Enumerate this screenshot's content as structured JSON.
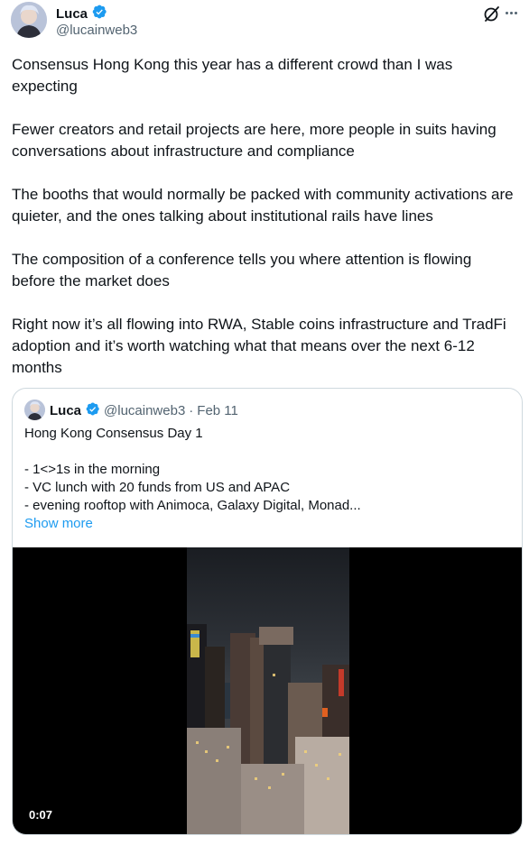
{
  "author": {
    "name": "Luca",
    "handle": "@lucainweb3",
    "verified": true
  },
  "post": {
    "paragraphs": [
      "Consensus Hong Kong this year has a different crowd than I was expecting",
      "Fewer creators and retail projects are here, more people in suits having conversations about infrastructure and compliance",
      "The booths that would normally be packed with community activations are quieter, and the ones talking about institutional rails have lines",
      "The composition of a conference tells you where attention is flowing before the market does",
      "Right now it’s all flowing into RWA, Stable coins infrastructure and TradFi adoption and it’s worth watching what that means over the next 6-12 months"
    ]
  },
  "quote": {
    "name": "Luca",
    "handle": "@lucainweb3",
    "separator": "·",
    "date": "Feb 11",
    "lines": [
      "Hong Kong Consensus Day 1",
      "",
      "- 1<>1s in the morning",
      "- VC lunch with 20 funds from US and APAC",
      "- evening rooftop with Animoca, Galaxy Digital, Monad..."
    ],
    "show_more": "Show more",
    "video_duration": "0:07"
  },
  "colors": {
    "verified": "#1d9bf0",
    "link": "#1d9bf0",
    "muted": "#536471",
    "border": "#cfd9de"
  },
  "icons": [
    "verified-badge-icon",
    "grok-icon",
    "more-icon"
  ]
}
